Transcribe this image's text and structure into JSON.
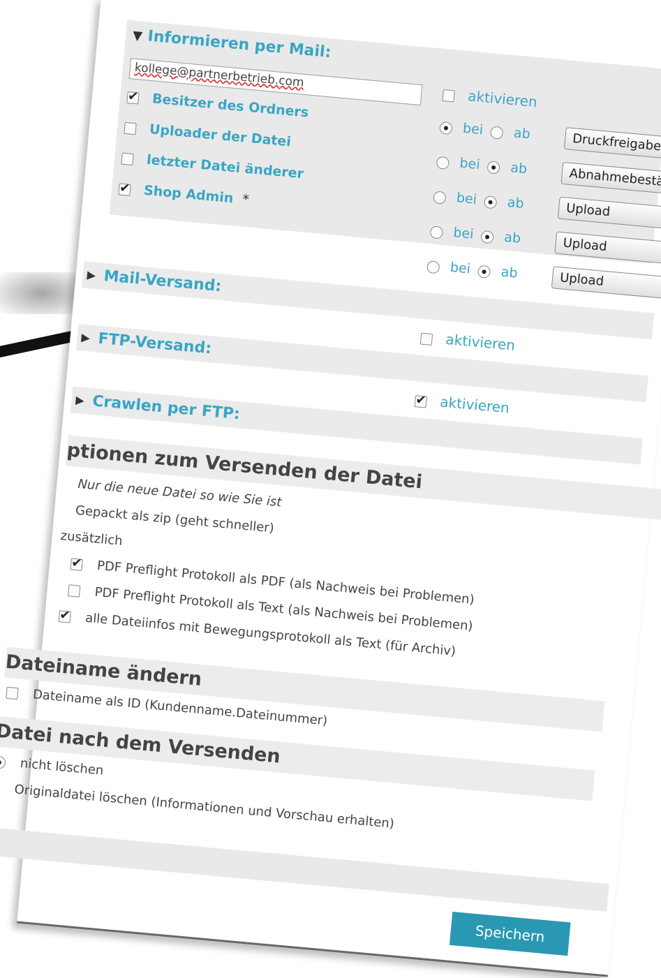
{
  "mail_section": {
    "title": "Informieren per Mail:",
    "activate_label": "aktivieren",
    "email_value": "kollege@partnerbetrieb.com",
    "recipients": [
      {
        "label": "Besitzer des Ordners",
        "checked": true
      },
      {
        "label": "Uploader der Datei",
        "checked": false
      },
      {
        "label": "letzter Datei änderer",
        "checked": false
      },
      {
        "label": "Shop Admin",
        "suffix": "*",
        "checked": true
      }
    ],
    "bei_label": "bei",
    "ab_label": "ab",
    "rows": [
      {
        "bei": true,
        "select": "Druckfreigabe"
      },
      {
        "bei": false,
        "select": "Abnahmebestätigung"
      },
      {
        "bei": false,
        "select": "Upload"
      },
      {
        "bei": false,
        "select": "Upload"
      },
      {
        "bei": false,
        "select": "Upload"
      }
    ]
  },
  "mail_versand": {
    "title": "Mail-Versand:",
    "activate_label": "aktivieren",
    "checked": false
  },
  "ftp_versand": {
    "title": "FTP-Versand:",
    "activate_label": "aktivieren",
    "checked": true
  },
  "crawlen": {
    "title": "Crawlen per FTP:"
  },
  "options": {
    "title": "ptionen zum Versenden der Datei",
    "line1": "Nur die neue Datei so wie Sie ist",
    "line2": "Gepackt als zip  (geht schneller)",
    "zusatz": "zusätzlich",
    "items": [
      {
        "label": "PDF Preflight Protokoll als PDF  (als Nachweis bei Problemen)",
        "checked": true
      },
      {
        "label": "PDF Preflight Protokoll als Text  (als Nachweis bei Problemen)",
        "checked": false
      },
      {
        "label": "alle Dateiinfos mit Bewegungsprotokoll als Text  (für Archiv)",
        "checked": true
      }
    ]
  },
  "rename": {
    "title": "Dateiname ändern",
    "item": "Dateiname als ID  (Kundenname.Dateinummer)",
    "checked": false
  },
  "after_send": {
    "title": "Datei nach dem Versenden",
    "options": [
      {
        "label": "nicht löschen",
        "selected": true
      },
      {
        "label": "Originaldatei löschen  (Informationen und Vorschau erhalten)",
        "selected": false
      }
    ]
  },
  "save_label": "Speichern"
}
